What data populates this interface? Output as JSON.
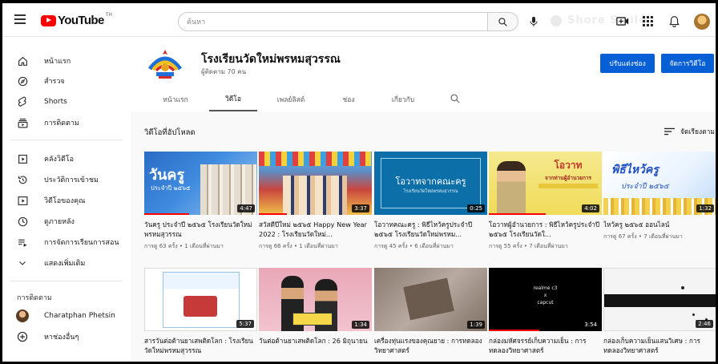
{
  "app": {
    "logo_text": "YouTube",
    "logo_sup": "TH"
  },
  "search": {
    "placeholder": "ค้นหา"
  },
  "topbar": {
    "ghost_text": "Shore Smile"
  },
  "sidebar": {
    "items": [
      {
        "label": "หน้าแรก",
        "icon": "home-icon"
      },
      {
        "label": "สำรวจ",
        "icon": "explore-icon"
      },
      {
        "label": "Shorts",
        "icon": "shorts-icon"
      },
      {
        "label": "การติดตาม",
        "icon": "subscriptions-icon"
      },
      {
        "label": "คลังวิดีโอ",
        "icon": "library-icon"
      },
      {
        "label": "ประวัติการเข้าชม",
        "icon": "history-icon"
      },
      {
        "label": "วิดีโอของคุณ",
        "icon": "your-videos-icon"
      },
      {
        "label": "ดูภายหลัง",
        "icon": "watch-later-icon"
      },
      {
        "label": "การจัดการเรียนการสอน",
        "icon": "playlist-icon"
      },
      {
        "label": "แสดงเพิ่มเติม",
        "icon": "chevron-down-icon"
      }
    ],
    "subscriptions_heading": "การติดตาม",
    "subscriptions": [
      {
        "label": "Charatphan Phetsin"
      }
    ],
    "browse_channels": "หาช่องอื่นๆ"
  },
  "channel": {
    "name": "โรงเรียนวัดใหม่พรหมสุวรรณ",
    "subscribers": "ผู้ติดตาม 70 คน",
    "customize_label": "ปรับแต่งช่อง",
    "manage_label": "จัดการวิดีโอ"
  },
  "tabs": [
    "หน้าแรก",
    "วิดีโอ",
    "เพลย์ลิสต์",
    "ช่อง",
    "เกี่ยวกับ"
  ],
  "section": {
    "title": "วิดีโอที่อัปโหลด",
    "sort_label": "จัดเรียงตาม"
  },
  "videos": [
    {
      "title": "วันครู ประจำปี ๒๕๖๕ โรงเรียนวัดใหม่พรหมสุวรรณ",
      "meta": "การดู 63 ครั้ง • 1 เดือนที่ผ่านมา",
      "duration": "4:47",
      "thumb_text": "วันครู",
      "thumb_sub": "ประจำปี ๒๕๖๕",
      "watched": 0.4
    },
    {
      "title": "สวัสดีปีใหม่ ๒๕๖๕ Happy New Year 2022 : โรงเรียนวัดใหม่...",
      "meta": "การดู 66 ครั้ง • 1 เดือนที่ผ่านมา",
      "duration": "3:37",
      "watched": 0.25
    },
    {
      "title": "โอวาทคณะครู : พิธีไหว้ครูประจำปี ๒๕๖๕ โรงเรียนวัดใหม่พรหม...",
      "meta": "การดู 45 ครั้ง • 6 เดือนที่ผ่านมา",
      "duration": "0:25",
      "thumb_text": "โอวาทจากคณะครู",
      "thumb_sub": "โรงเรียนวัดใหม่พรหมสุวรรณ",
      "watched": 0
    },
    {
      "title": "โอวาทผู้อำนวยการ : พิธีไหว้ครูประจำปี ๒๕๖๕ โรงเรียนวัดใ...",
      "meta": "การดู 55 ครั้ง • 7 เดือนที่ผ่านมา",
      "duration": "4:02",
      "thumb_text": "โอวาท",
      "thumb_sub": "จากท่านผู้อำนวยการ",
      "watched": 0.5
    },
    {
      "title": "ไหว้ครู ๒๕๖๕ ออนไลน์",
      "meta": "การดู 67 ครั้ง • 7 เดือนที่ผ่านมา",
      "duration": "1:32",
      "thumb_text": "พิธีไหว้ครู",
      "thumb_sub": "ประจำปี ๒๕๖๕",
      "watched": 0
    },
    {
      "title": "สารวันต่อต้านยาเสพติดโลก : โรงเรียนวัดใหม่พรหมสุวรรณ",
      "meta": "",
      "duration": "5:37",
      "watched": 0
    },
    {
      "title": "วันต่อต้านยาเสพติดโลก : 26 มิถุนายน",
      "meta": "",
      "duration": "1:34",
      "watched": 0
    },
    {
      "title": "เครื่องทุ่นแรงของคุณยาย : การทดลองวิทยาศาสตร์",
      "meta": "",
      "duration": "1:39",
      "watched": 0
    },
    {
      "title": "กล่องมหัศจรรย์เก็บความเย็น : การทดลองวิทยาศาสตร์",
      "meta": "",
      "duration": "3:54",
      "thumb_text": "realme c3",
      "thumb_sub": "x",
      "thumb_sub2": "capcut",
      "watched": 0.45
    },
    {
      "title": "กล่องเก็บความเย็นแสนวิเศษ : การทดลองวิทยาศาสตร์",
      "meta": "",
      "duration": "2:46",
      "watched": 0
    }
  ]
}
